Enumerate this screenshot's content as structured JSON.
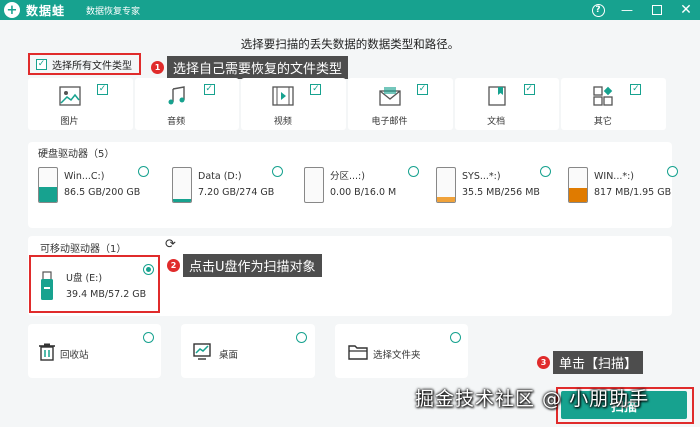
{
  "app": {
    "logo_glyph": "+",
    "name": "数据蛙",
    "subtitle": "数据恢复专家",
    "help_glyph": "?",
    "min_glyph": "—",
    "close_glyph": "✕"
  },
  "instruction": "选择要扫描的丢失数据的数据类型和路径。",
  "select_all": {
    "label": "选择所有文件类型",
    "checked": true,
    "mark": "✓"
  },
  "callouts": [
    {
      "num": "1",
      "text": "选择自己需要恢复的文件类型"
    },
    {
      "num": "2",
      "text": "点击U盘作为扫描对象"
    },
    {
      "num": "3",
      "text": "单击【扫描】"
    }
  ],
  "file_types": [
    {
      "label": "图片",
      "icon": "image-icon",
      "checked": true
    },
    {
      "label": "音频",
      "icon": "music-icon",
      "checked": true
    },
    {
      "label": "视频",
      "icon": "video-icon",
      "checked": true
    },
    {
      "label": "电子邮件",
      "icon": "email-icon",
      "checked": true
    },
    {
      "label": "文档",
      "icon": "document-icon",
      "checked": true
    },
    {
      "label": "其它",
      "icon": "other-icon",
      "checked": true
    }
  ],
  "hard_drives": {
    "title": "硬盘驱动器（5）",
    "items": [
      {
        "name": "Win...C:)",
        "size": "86.5 GB/200 GB",
        "used_fraction": 0.43,
        "fill_color": "#17a28f",
        "icon": "windows-drive-icon"
      },
      {
        "name": "Data (D:)",
        "size": "7.20 GB/274 GB",
        "used_fraction": 0.03,
        "fill_color": "#17a28f",
        "icon": "drive-icon"
      },
      {
        "name": "分区...:)",
        "size": "0.00  B/16.0 M",
        "used_fraction": 0.0,
        "fill_color": "#f0a23a",
        "icon": "drive-icon"
      },
      {
        "name": "SYS...*:)",
        "size": "35.5 MB/256 MB",
        "used_fraction": 0.14,
        "fill_color": "#f0a23a",
        "icon": "drive-icon"
      },
      {
        "name": "WIN...*:)",
        "size": "817 MB/1.95 GB",
        "used_fraction": 0.42,
        "fill_color": "#e07b00",
        "icon": "drive-icon"
      }
    ]
  },
  "removable": {
    "title": "可移动驱动器（1）",
    "refresh_glyph": "⟳",
    "items": [
      {
        "name": "U盘 (E:)",
        "size": "39.4 MB/57.2 GB",
        "selected": true,
        "icon": "usb-drive-icon"
      }
    ]
  },
  "locations": [
    {
      "label": "回收站",
      "icon": "recycle-bin-icon"
    },
    {
      "label": "桌面",
      "icon": "desktop-icon"
    },
    {
      "label": "选择文件夹",
      "icon": "folder-icon"
    }
  ],
  "scan_button": "扫描",
  "watermark": "掘金技术社区 @ 小朋助手",
  "colors": {
    "accent": "#17a28f",
    "callout_red": "#e02b2b"
  }
}
